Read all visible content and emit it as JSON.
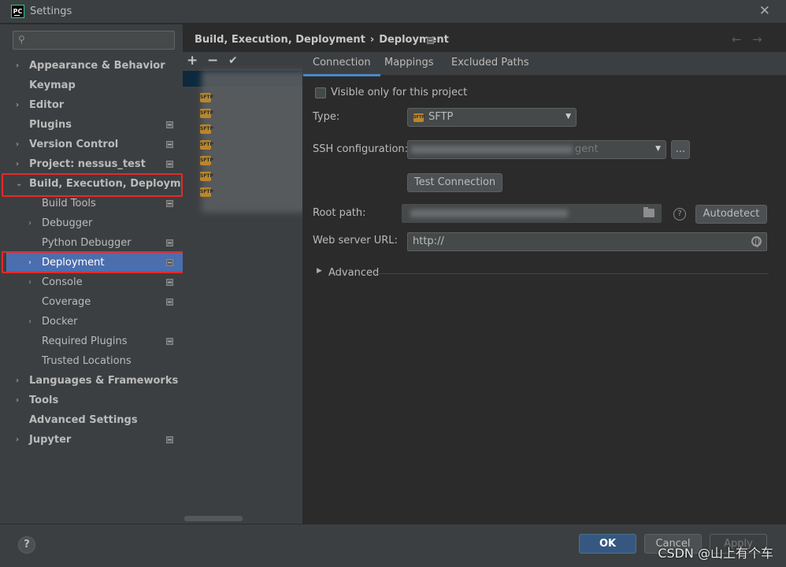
{
  "window": {
    "title": "Settings",
    "app_icon_text": "PC"
  },
  "search": {
    "placeholder": "",
    "icon": "search-icon"
  },
  "sidebar": {
    "items": [
      {
        "label": "Appearance & Behavior",
        "arrow": "›",
        "bold": true
      },
      {
        "label": "Keymap",
        "bold": true
      },
      {
        "label": "Editor",
        "arrow": "›",
        "bold": true
      },
      {
        "label": "Plugins",
        "bold": true,
        "project_icon": true
      },
      {
        "label": "Version Control",
        "arrow": "›",
        "bold": true,
        "project_icon": true
      },
      {
        "label": "Project: nessus_test",
        "arrow": "›",
        "bold": true,
        "project_icon": true
      },
      {
        "label": "Build, Execution, Deployment",
        "arrow": "⌄",
        "bold": true
      },
      {
        "label": "Build Tools",
        "child": true,
        "project_icon": true
      },
      {
        "label": "Debugger",
        "child": true,
        "arrow": "›"
      },
      {
        "label": "Python Debugger",
        "child": true,
        "project_icon": true
      },
      {
        "label": "Deployment",
        "child": true,
        "arrow": "›",
        "selected": true,
        "project_icon": true
      },
      {
        "label": "Console",
        "child": true,
        "arrow": "›",
        "project_icon": true
      },
      {
        "label": "Coverage",
        "child": true,
        "project_icon": true
      },
      {
        "label": "Docker",
        "child": true,
        "arrow": "›"
      },
      {
        "label": "Required Plugins",
        "child": true,
        "project_icon": true
      },
      {
        "label": "Trusted Locations",
        "child": true
      },
      {
        "label": "Languages & Frameworks",
        "arrow": "›",
        "bold": true
      },
      {
        "label": "Tools",
        "arrow": "›",
        "bold": true
      },
      {
        "label": "Advanced Settings",
        "bold": true
      },
      {
        "label": "Jupyter",
        "arrow": "›",
        "bold": true,
        "project_icon": true
      }
    ]
  },
  "breadcrumb": {
    "parent": "Build, Execution, Deployment",
    "separator": "›",
    "current": "Deployment"
  },
  "toolbar": {
    "add": "+",
    "remove": "−",
    "apply": "✔"
  },
  "tabs": [
    {
      "label": "Connection",
      "active": true
    },
    {
      "label": "Mappings"
    },
    {
      "label": "Excluded Paths"
    }
  ],
  "connection": {
    "visible_only_label": "Visible only for this project",
    "type_label": "Type:",
    "type_value": "SFTP",
    "ssh_label": "SSH configuration:",
    "ssh_value_tail": "gent",
    "ssh_more_button": "...",
    "test_connection_button": "Test Connection",
    "root_path_label": "Root path:",
    "help_mark": "?",
    "autodetect_button": "Autodetect",
    "web_server_label": "Web server URL:",
    "web_server_value": "http://",
    "advanced_label": "Advanced"
  },
  "server_icon_text": "SFTP",
  "footer": {
    "help": "?",
    "ok": "OK",
    "cancel": "Cancel",
    "apply": "Apply",
    "watermark": "CSDN @山上有个车"
  },
  "colors": {
    "accent": "#4b6eaf",
    "highlight_red": "#e52a2a",
    "ok_button": "#365880"
  }
}
